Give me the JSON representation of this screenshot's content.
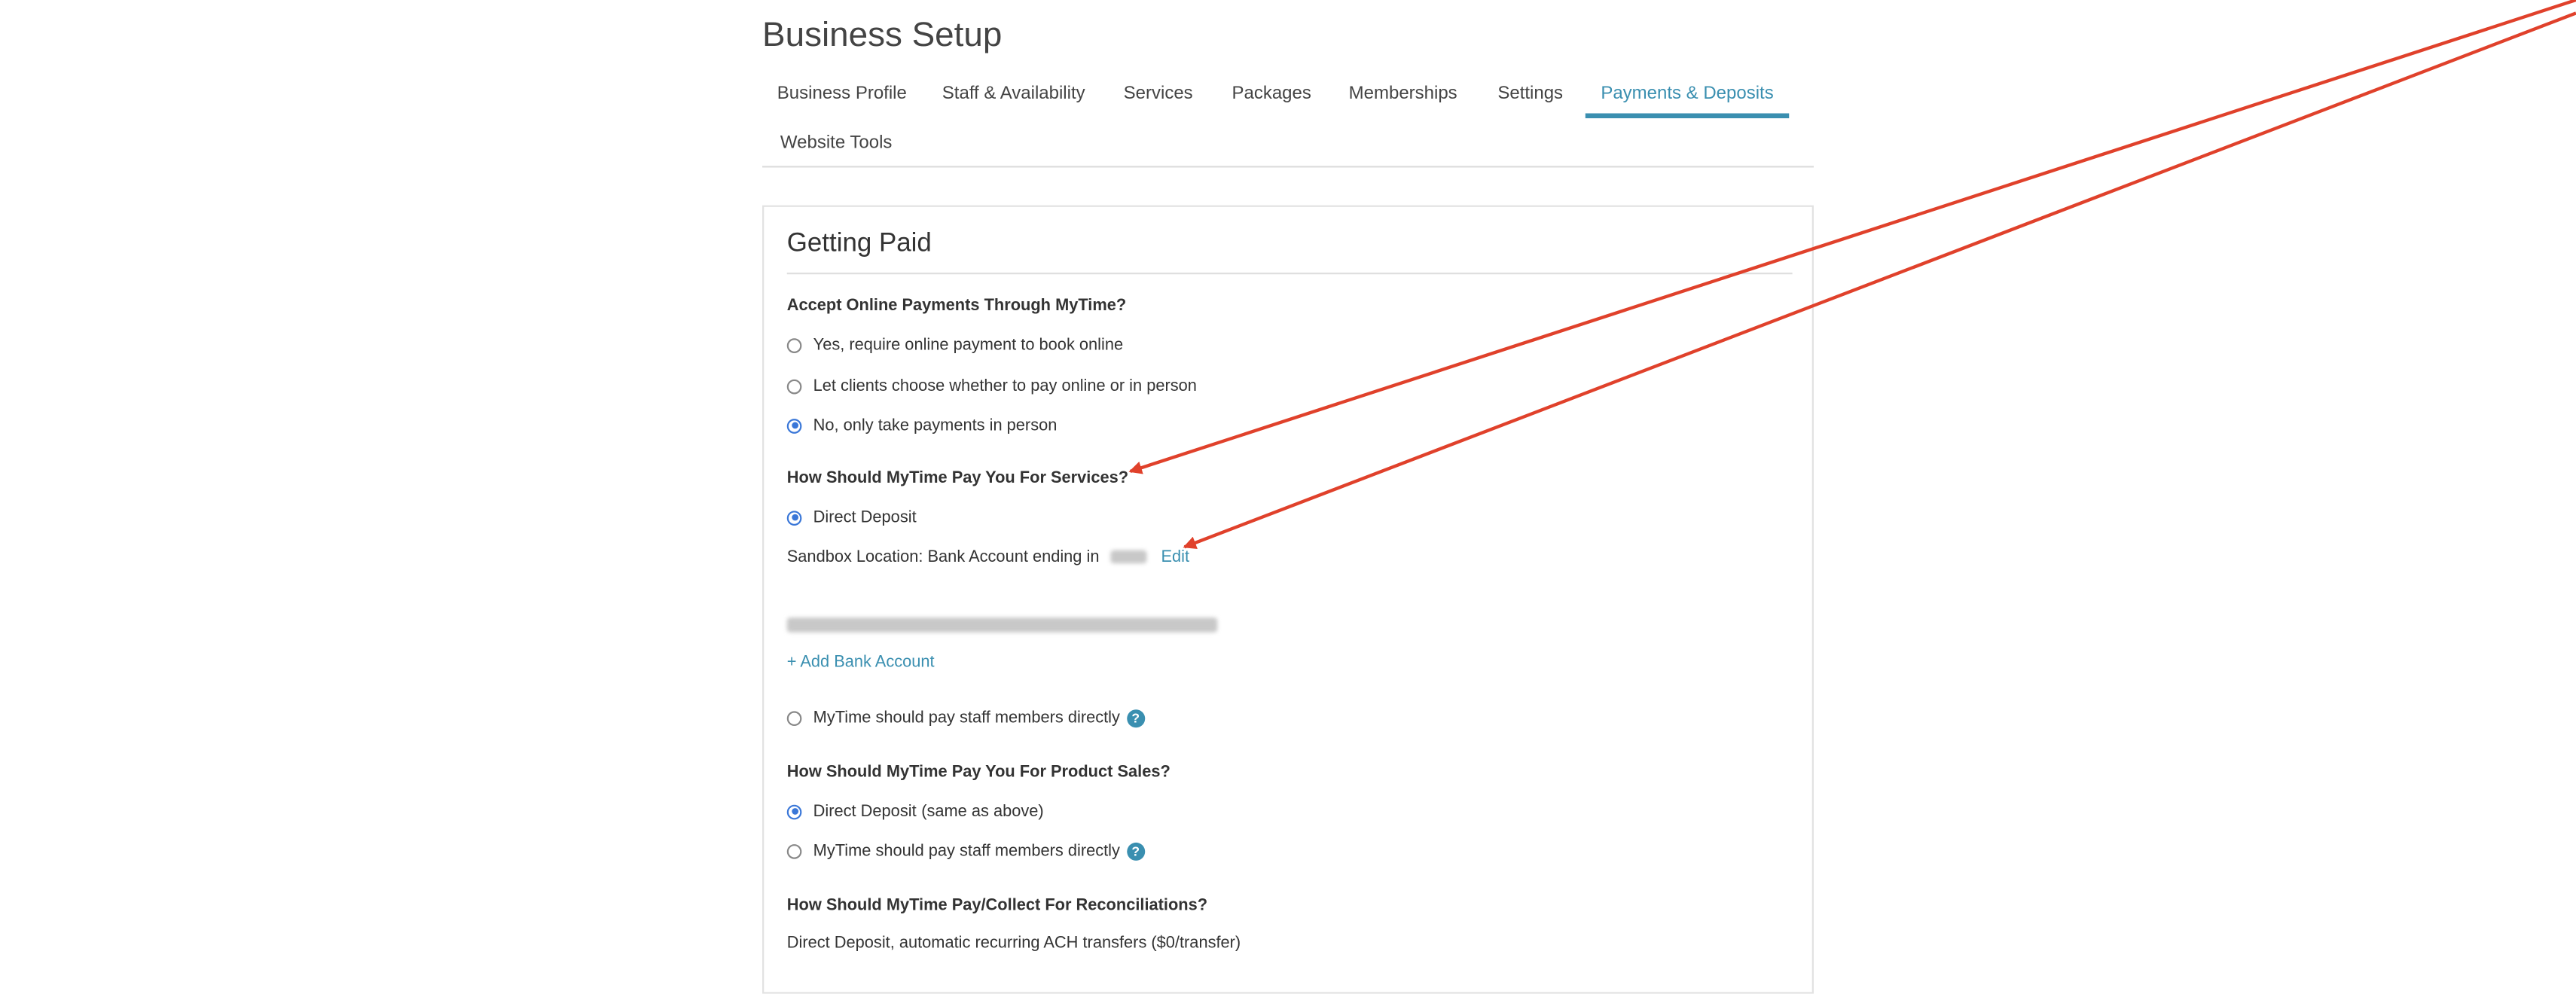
{
  "header": {
    "title": "Business Setup"
  },
  "tabs": [
    {
      "label": "Business Profile",
      "active": false
    },
    {
      "label": "Staff & Availability",
      "active": false
    },
    {
      "label": "Services",
      "active": false
    },
    {
      "label": "Packages",
      "active": false
    },
    {
      "label": "Memberships",
      "active": false
    },
    {
      "label": "Settings",
      "active": false
    },
    {
      "label": "Payments & Deposits",
      "active": true
    },
    {
      "label": "Website Tools",
      "active": false
    }
  ],
  "section": {
    "title": "Getting Paid",
    "online_payments": {
      "question": "Accept Online Payments Through MyTime?",
      "options": [
        {
          "label": "Yes, require online payment to book online",
          "selected": false
        },
        {
          "label": "Let clients choose whether to pay online or in person",
          "selected": false
        },
        {
          "label": "No, only take payments in person",
          "selected": true
        }
      ]
    },
    "services_payout": {
      "question": "How Should MyTime Pay You For Services?",
      "direct_deposit_label": "Direct Deposit",
      "bank_account_text": "Sandbox Location: Bank Account ending in",
      "edit_label": "Edit",
      "add_bank_label": "+ Add Bank Account",
      "pay_staff_label": "MyTime should pay staff members directly",
      "help_glyph": "?"
    },
    "product_payout": {
      "question": "How Should MyTime Pay You For Product Sales?",
      "direct_deposit_label": "Direct Deposit",
      "same_as_above": "(same as above)",
      "pay_staff_label": "MyTime should pay staff members directly",
      "help_glyph": "?"
    },
    "reconciliations": {
      "question": "How Should MyTime Pay/Collect For Reconciliations?",
      "text": "Direct Deposit, automatic recurring ACH transfers ($0/transfer)"
    }
  },
  "colors": {
    "accent": "#3a8fb0",
    "radio_checked": "#3a77d8",
    "annotation_arrow": "#e0412b"
  }
}
